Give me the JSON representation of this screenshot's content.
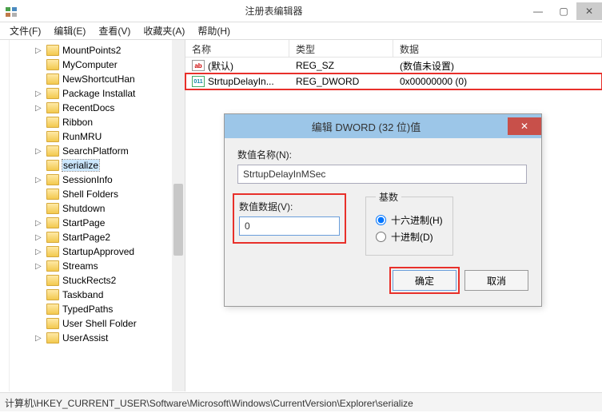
{
  "window": {
    "title": "注册表编辑器",
    "min": "—",
    "max": "▢",
    "close": "✕"
  },
  "menu": {
    "file": "文件(F)",
    "edit": "编辑(E)",
    "view": "查看(V)",
    "favorites": "收藏夹(A)",
    "help": "帮助(H)"
  },
  "tree": {
    "items": [
      {
        "label": "MountPoints2",
        "expandable": true
      },
      {
        "label": "MyComputer",
        "expandable": false
      },
      {
        "label": "NewShortcutHan",
        "expandable": false
      },
      {
        "label": "Package Installat",
        "expandable": true
      },
      {
        "label": "RecentDocs",
        "expandable": true
      },
      {
        "label": "Ribbon",
        "expandable": false
      },
      {
        "label": "RunMRU",
        "expandable": false
      },
      {
        "label": "SearchPlatform",
        "expandable": true
      },
      {
        "label": "serialize",
        "expandable": false,
        "selected": true
      },
      {
        "label": "SessionInfo",
        "expandable": true
      },
      {
        "label": "Shell Folders",
        "expandable": false
      },
      {
        "label": "Shutdown",
        "expandable": false
      },
      {
        "label": "StartPage",
        "expandable": true
      },
      {
        "label": "StartPage2",
        "expandable": true
      },
      {
        "label": "StartupApproved",
        "expandable": true
      },
      {
        "label": "Streams",
        "expandable": true
      },
      {
        "label": "StuckRects2",
        "expandable": false
      },
      {
        "label": "Taskband",
        "expandable": false
      },
      {
        "label": "TypedPaths",
        "expandable": false
      },
      {
        "label": "User Shell Folder",
        "expandable": false
      },
      {
        "label": "UserAssist",
        "expandable": true
      }
    ]
  },
  "list": {
    "columns": {
      "name": "名称",
      "type": "类型",
      "data": "数据"
    },
    "rows": [
      {
        "icon": "ab",
        "name": "(默认)",
        "type": "REG_SZ",
        "data": "(数值未设置)"
      },
      {
        "icon": "011",
        "name": "StrtupDelayIn...",
        "type": "REG_DWORD",
        "data": "0x00000000 (0)",
        "highlight": true
      }
    ]
  },
  "dialog": {
    "title": "编辑 DWORD (32 位)值",
    "close": "✕",
    "name_label": "数值名称(N):",
    "name_value": "StrtupDelayInMSec",
    "value_label": "数值数据(V):",
    "value_value": "0",
    "base": {
      "legend": "基数",
      "hex": "十六进制(H)",
      "dec": "十进制(D)"
    },
    "ok": "确定",
    "cancel": "取消"
  },
  "statusbar": "计算机\\HKEY_CURRENT_USER\\Software\\Microsoft\\Windows\\CurrentVersion\\Explorer\\serialize"
}
